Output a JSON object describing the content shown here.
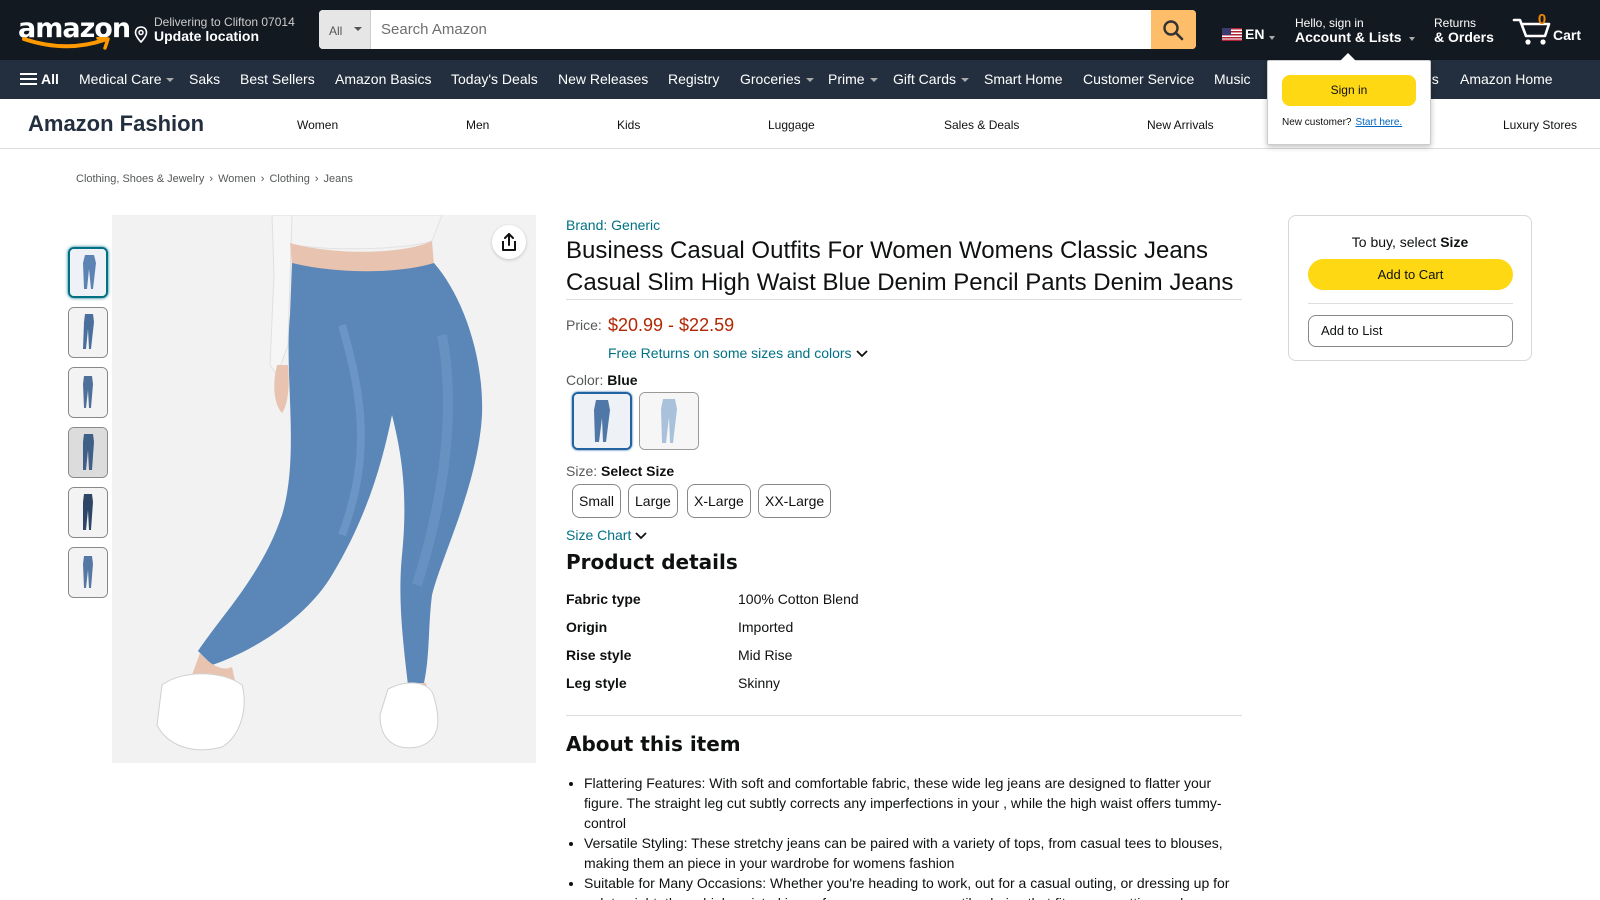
{
  "header": {
    "logo_alt": "amazon",
    "deliver_line1": "Delivering to Clifton 07014",
    "deliver_line2": "Update location",
    "search_category": "All",
    "search_placeholder": "Search Amazon",
    "language": "EN",
    "account_line1": "Hello, sign in",
    "account_line2": "Account & Lists",
    "returns_line1": "Returns",
    "returns_line2": "& Orders",
    "cart_count": "0",
    "cart_label": "Cart",
    "colors": {
      "bg": "#131921",
      "search_button": "#febd69",
      "cart_count": "#f08804"
    }
  },
  "subnav": {
    "all_label": "All",
    "items": [
      "Medical Care",
      "Saks",
      "Best Sellers",
      "Amazon Basics",
      "Today's Deals",
      "New Releases",
      "Registry",
      "Groceries",
      "Prime",
      "Gift Cards",
      "Smart Home",
      "Customer Service",
      "Music",
      "es",
      "Amazon Home"
    ]
  },
  "signin_popover": {
    "button": "Sign in",
    "new_customer": "New customer?",
    "start_here": "Start here."
  },
  "fashion": {
    "brand": "Amazon Fashion",
    "items": [
      "Women",
      "Men",
      "Kids",
      "Luggage",
      "Sales & Deals",
      "New Arrivals",
      "Luxury Stores"
    ]
  },
  "breadcrumb": [
    "Clothing, Shoes & Jewelry",
    "Women",
    "Clothing",
    "Jeans"
  ],
  "product": {
    "brand": "Brand: Generic",
    "title": "Business Casual Outfits For Women Womens Classic Jeans Casual Slim High Waist Blue Denim Pencil Pants Denim Jeans",
    "price_label": "Price:",
    "price": "$20.99 - $22.59",
    "free_returns": "Free Returns on some sizes and colors",
    "color_label": "Color:",
    "color_value": "Blue",
    "size_label": "Size:",
    "size_value": "Select Size",
    "sizes": [
      "Small",
      "Large",
      "X-Large",
      "XX-Large"
    ],
    "size_chart": "Size Chart",
    "details_heading": "Product details",
    "details": [
      {
        "label": "Fabric type",
        "value": "100% Cotton Blend"
      },
      {
        "label": "Origin",
        "value": "Imported"
      },
      {
        "label": "Rise style",
        "value": "Mid Rise"
      },
      {
        "label": "Leg style",
        "value": "Skinny"
      }
    ],
    "about_heading": "About this item",
    "bullets": [
      "Flattering Features: With soft and comfortable fabric, these wide leg jeans are designed to flatter your figure. The straight leg cut subtly corrects any imperfections in your , while the high waist offers tummy-control",
      "Versatile Styling: These stretchy jeans can be paired with a variety of tops, from casual tees to blouses, making them an piece in your wardrobe for womens fashion",
      "Suitable for Many Occasions: Whether you're heading to work, out for a casual outing, or dressing up for a date night, these high waisted jeans for women are a versatile choice that fits every setting and"
    ]
  },
  "buybox": {
    "to_buy": "To buy, select",
    "to_buy_bold": "Size",
    "add_to_cart": "Add to Cart",
    "add_to_list": "Add to List"
  }
}
